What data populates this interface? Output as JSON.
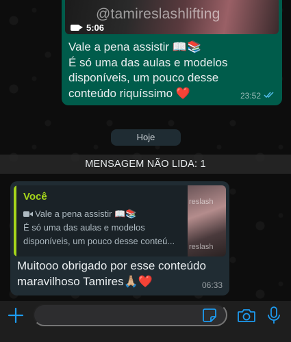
{
  "outgoing_message": {
    "video": {
      "watermark": "@tamireslashlifting",
      "duration": "5:06"
    },
    "lines": [
      "Vale a pena assistir 📖📚",
      "É só uma das aulas  e modelos",
      "disponíveis, um pouco desse",
      "conteúdo riquíssimo ❤️"
    ],
    "time": "23:52",
    "status_icon": "double-check-read"
  },
  "day_separator": "Hoje",
  "unread_banner": "MENSAGEM NÃO LIDA: 1",
  "incoming_message": {
    "quote": {
      "author": "Você",
      "lines": [
        "Vale a pena assistir 📖📚",
        "É só uma das aulas  e modelos",
        "disponíveis, um pouco desse conteú..."
      ],
      "thumb_watermark": "reslash"
    },
    "lines": [
      "Muitooo obrigado por esse conteúdo",
      "maravilhoso Tamires🙏🏼❤️"
    ],
    "time": "06:33"
  },
  "composer": {
    "placeholder": "",
    "icons": [
      "plus-icon",
      "sticker-icon",
      "camera-icon",
      "mic-icon"
    ]
  },
  "colors": {
    "outgoing_bubble": "#005c4b",
    "incoming_bubble": "#202c33",
    "quote_accent": "#a5d51b",
    "read_ticks": "#53bdeb",
    "icon_blue": "#1d9bf0"
  }
}
